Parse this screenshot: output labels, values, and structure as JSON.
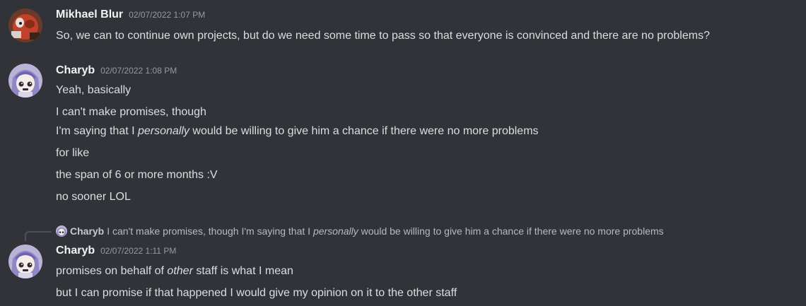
{
  "messages": [
    {
      "username": "Mikhael Blur",
      "timestamp": "02/07/2022 1:07 PM",
      "lines": [
        "So, we can to continue own projects, but do we need some time to pass so that everyone is convinced and there are no problems?"
      ]
    },
    {
      "username": "Charyb",
      "timestamp": "02/07/2022 1:08 PM",
      "lines": [
        "Yeah, basically",
        "I can't make promises, though",
        {
          "before": "I'm saying that I ",
          "italic": "personally",
          "after": " would be willing to give him a chance if there were no more problems"
        },
        "for like",
        "the span of 6 or more months :V",
        "no sooner LOL"
      ]
    },
    {
      "reply": {
        "username": "Charyb",
        "before": "I can't make promises, though I'm saying that I ",
        "italic": "personally",
        "after": " would be willing to give him a chance if there were no more problems"
      },
      "username": "Charyb",
      "timestamp": "02/07/2022 1:11 PM",
      "lines": [
        {
          "before": "promises on behalf of ",
          "italic": "other",
          "after": " staff is what I mean"
        },
        "but I can promise if that happened I would give my opinion on it to the other staff"
      ]
    }
  ],
  "avatars": {
    "mikhael": "red-panda-avatar",
    "charyb": "anime-girl-avatar"
  },
  "colors": {
    "background": "#313338",
    "username": "#f2f3f5",
    "text": "#dbdee1",
    "timestamp": "#949ba4"
  }
}
